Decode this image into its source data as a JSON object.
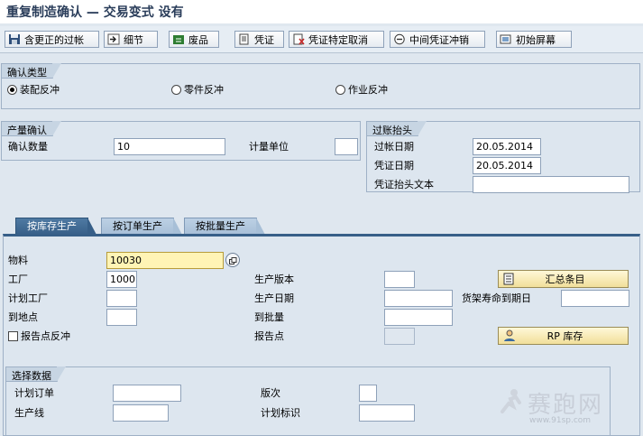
{
  "title": "重复制造确认 — 交易变式 设有",
  "toolbar": {
    "buttons": [
      {
        "label": "含更正的过帐",
        "icon": "save-disk-icon"
      },
      {
        "label": "细节",
        "icon": "arrow-right-icon"
      },
      {
        "label": "废品",
        "icon": "scrap-icon"
      },
      {
        "label": "凭证",
        "icon": "document-icon"
      },
      {
        "label": "凭证特定取消",
        "icon": "cancel-document-icon"
      },
      {
        "label": "中间凭证冲销",
        "icon": "minus-circle-icon"
      },
      {
        "label": "初始屏幕",
        "icon": "initial-screen-icon"
      }
    ]
  },
  "confirm_type": {
    "title": "确认类型",
    "options": [
      {
        "label": "装配反冲",
        "selected": true
      },
      {
        "label": "零件反冲",
        "selected": false
      },
      {
        "label": "作业反冲",
        "selected": false
      }
    ]
  },
  "output_confirm": {
    "title": "产量确认",
    "qty_label": "确认数量",
    "qty_value": "10",
    "uom_label": "计量单位",
    "uom_value": ""
  },
  "posting_header": {
    "title": "过账抬头",
    "posting_date_label": "过帐日期",
    "posting_date": "20.05.2014",
    "doc_date_label": "凭证日期",
    "doc_date": "20.05.2014",
    "header_text_label": "凭证抬头文本",
    "header_text": ""
  },
  "tabs": [
    {
      "label": "按库存生产",
      "active": true
    },
    {
      "label": "按订单生产",
      "active": false
    },
    {
      "label": "按批量生产",
      "active": false
    }
  ],
  "main": {
    "material_label": "物料",
    "material_value": "10030",
    "plant_label": "工厂",
    "plant_value": "1000",
    "planning_plant_label": "计划工厂",
    "planning_plant_value": "",
    "receiving_loc_label": "到地点",
    "receiving_loc_value": "",
    "reporting_point_backflush_label": "报告点反冲",
    "production_version_label": "生产版本",
    "production_version_value": "",
    "production_date_label": "生产日期",
    "production_date_value": "",
    "to_batch_label": "到批量",
    "to_batch_value": "",
    "reporting_point_label": "报告点",
    "reporting_point_value": "",
    "shelf_life_label": "货架寿命到期日",
    "shelf_life_value": "",
    "summary_button": "汇总条目",
    "rp_stock_button": "RP 库存"
  },
  "selection": {
    "title": "选择数据",
    "planned_order_label": "计划订单",
    "planned_order_value": "",
    "production_line_label": "生产线",
    "production_line_value": "",
    "version_label": "版次",
    "version_value": "",
    "planning_id_label": "计划标识",
    "planning_id_value": ""
  },
  "watermark": {
    "text": "赛跑网",
    "url": "www.91sp.com"
  }
}
